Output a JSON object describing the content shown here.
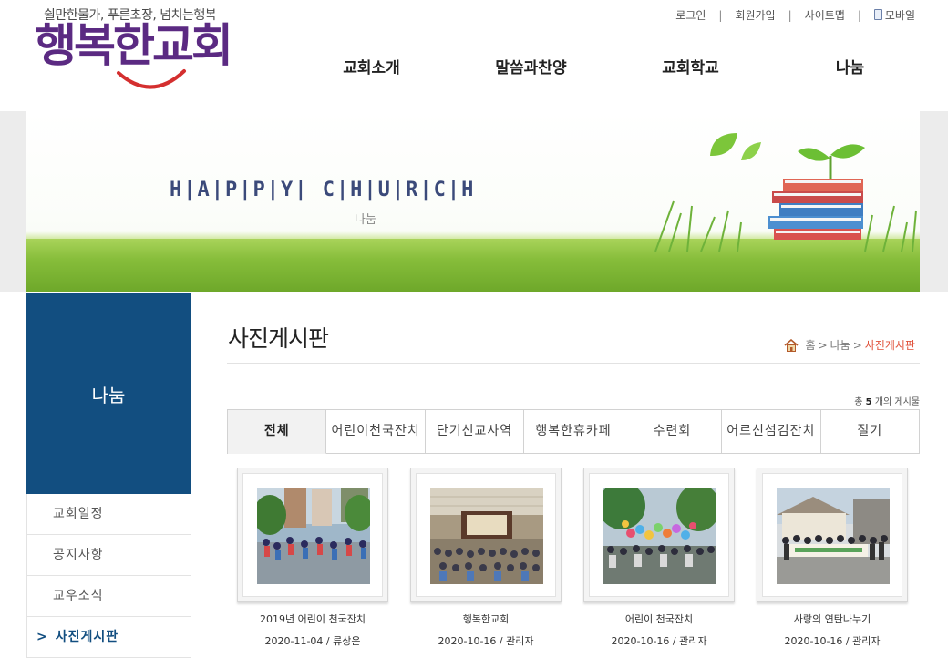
{
  "logo": {
    "tagline": "쉴만한물가, 푸른초장, 넘치는행복",
    "name": "행복한교회"
  },
  "util_links": {
    "login": "로그인",
    "join": "회원가입",
    "sitemap": "사이트맵",
    "mobile": "모바일"
  },
  "gnb": {
    "items": [
      "교회소개",
      "말씀과찬양",
      "교회학교",
      "나눔"
    ]
  },
  "banner": {
    "slogan": "H|A|P|P|Y| C|H|U|R|C|H",
    "subtitle": "나눔"
  },
  "lnb": {
    "title": "나눔",
    "items": [
      "교회일정",
      "공지사항",
      "교우소식",
      "사진게시판"
    ],
    "active_index": 3
  },
  "content": {
    "title": "사진게시판",
    "breadcrumb": {
      "home": "홈",
      "sep": ">",
      "section": "나눔",
      "current": "사진게시판"
    },
    "count": {
      "prefix": "총",
      "value": "5",
      "suffix": "개의 게시물"
    },
    "tabs": [
      "전체",
      "어린이천국잔치",
      "단기선교사역",
      "행복한휴카페",
      "수련회",
      "어르신섬김잔치",
      "절기"
    ],
    "active_tab": 0,
    "posts": [
      {
        "title": "2019년 어린이 천국잔치",
        "meta": "2020-11-04 / 류상은"
      },
      {
        "title": "행복한교회",
        "meta": "2020-10-16 / 관리자"
      },
      {
        "title": "어린이 천국잔치",
        "meta": "2020-10-16 / 관리자"
      },
      {
        "title": "사랑의 연탄나누기",
        "meta": "2020-10-16 / 관리자"
      }
    ]
  },
  "colors": {
    "brand_purple": "#5b2a82",
    "brand_green": "#3aa04a",
    "smile_red": "#d42f2f",
    "lnb_blue": "#124e80",
    "crumb_current": "#e0513a"
  }
}
